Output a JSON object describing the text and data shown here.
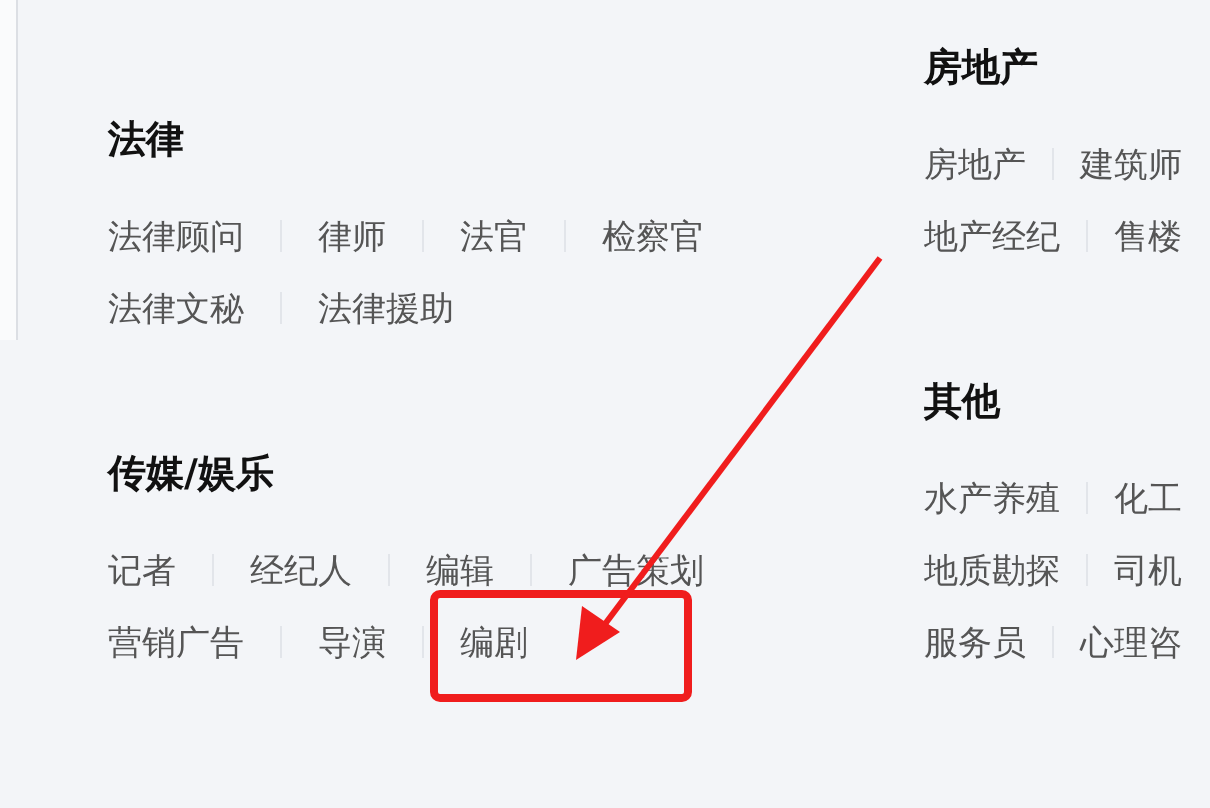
{
  "columns": [
    {
      "sections": [
        {
          "title": "法律",
          "rows": [
            [
              "法律顾问",
              "律师",
              "法官",
              "检察官"
            ],
            [
              "法律文秘",
              "法律援助"
            ]
          ]
        },
        {
          "title": "传媒/娱乐",
          "rows": [
            [
              "记者",
              "经纪人",
              "编辑",
              "广告策划"
            ],
            [
              "营销广告",
              "导演",
              "编剧"
            ]
          ]
        }
      ]
    },
    {
      "sections": [
        {
          "title": "房地产",
          "rows": [
            [
              "房地产",
              "建筑师"
            ],
            [
              "地产经纪",
              "售楼"
            ]
          ]
        },
        {
          "title": "其他",
          "rows": [
            [
              "水产养殖",
              "化工"
            ],
            [
              "地质勘探",
              "司机"
            ],
            [
              "服务员",
              "心理咨"
            ]
          ]
        }
      ]
    }
  ]
}
